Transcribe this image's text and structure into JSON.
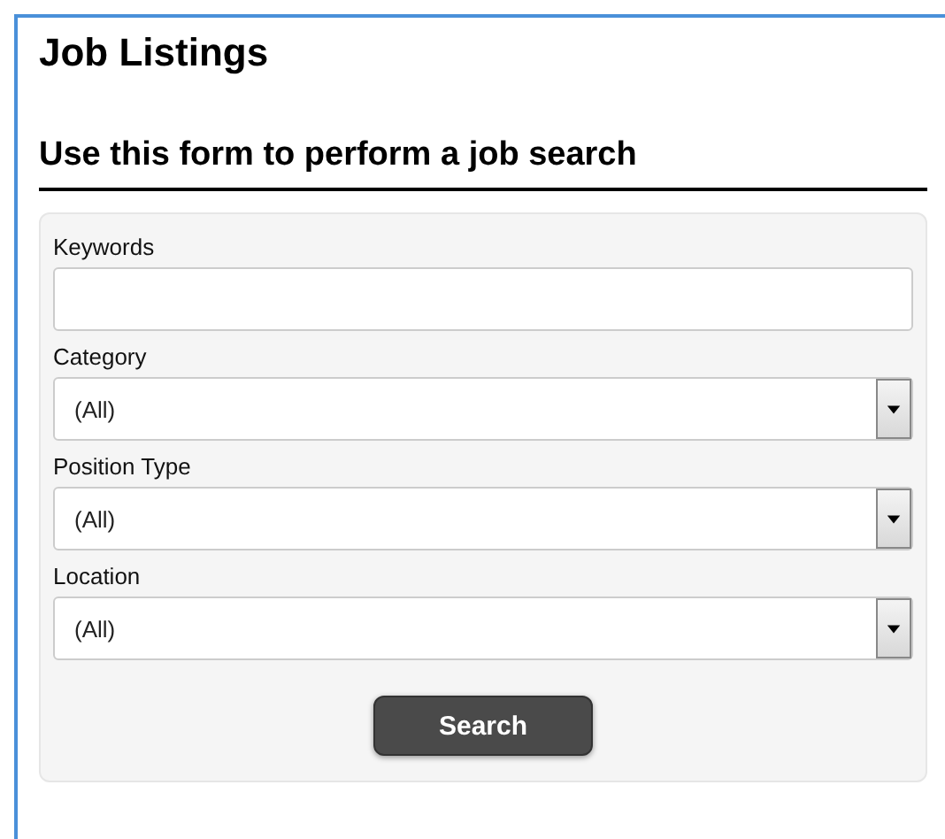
{
  "page": {
    "title": "Job Listings"
  },
  "form": {
    "heading": "Use this form to perform a job search",
    "fields": [
      {
        "kind": "text",
        "label": "Keywords"
      },
      {
        "kind": "select",
        "label": "Category",
        "value": "(All)"
      },
      {
        "kind": "select",
        "label": "Position Type",
        "value": "(All)"
      },
      {
        "kind": "select",
        "label": "Location",
        "value": "(All)"
      }
    ],
    "submit": "Search"
  }
}
